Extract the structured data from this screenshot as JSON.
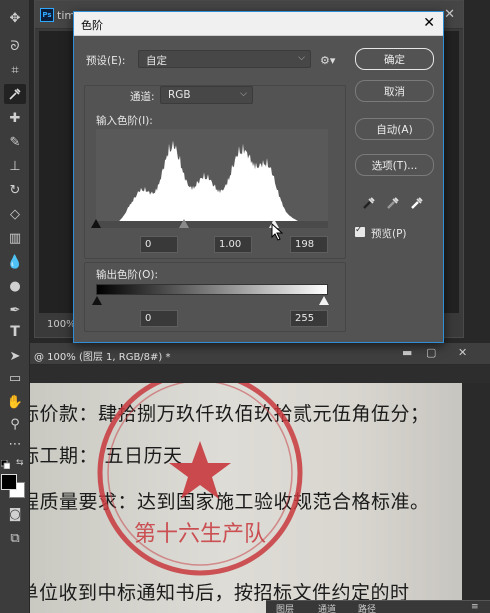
{
  "background_doc": {
    "tab_title": "tim",
    "zoom": "100%"
  },
  "levels_dialog": {
    "title": "色阶",
    "preset_label": "预设(E):",
    "preset_value": "自定",
    "channel_label": "通道:",
    "channel_value": "RGB",
    "input_levels_label": "输入色阶(I):",
    "input_black": "0",
    "input_gamma": "1.00",
    "input_white": "198",
    "output_levels_label": "输出色阶(O):",
    "output_black": "0",
    "output_white": "255",
    "buttons": {
      "ok": "确定",
      "cancel": "取消",
      "auto": "自动(A)",
      "options": "选项(T)..."
    },
    "preview_label": "预览(P)",
    "preview_checked": true
  },
  "main_doc": {
    "tab_title": "@ 100% (图层 1, RGB/8#) *",
    "lines": [
      "标价款：肆拾捌万玖仟玖佰玖拾贰元伍角伍分；",
      "标工期：     五日历天",
      "程质量要求：达到国家施工验收规范合格标准。",
      "你单位收到中标通知书后，按招标文件约定的时"
    ],
    "stamp_text": "第十六生产队"
  },
  "panel_tabs": [
    "图层",
    "通道",
    "路径"
  ]
}
